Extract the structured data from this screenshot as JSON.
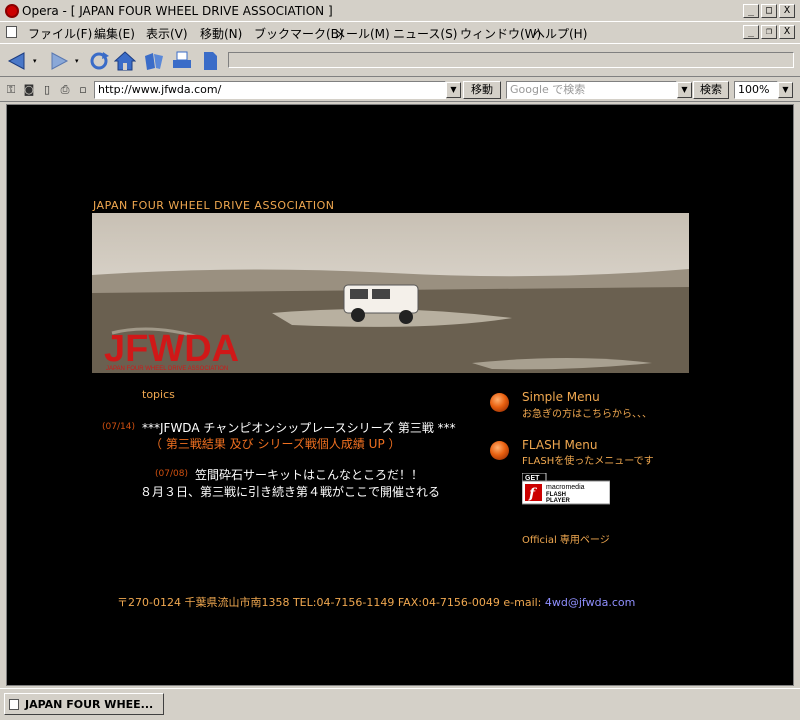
{
  "window": {
    "title": "Opera - [ JAPAN FOUR WHEEL DRIVE ASSOCIATION ]",
    "minimize_glyph": "_",
    "maximize_glyph": "□",
    "close_glyph": "X",
    "restore_glyph": "❐"
  },
  "menubar": {
    "items": [
      "ファイル(F)",
      "編集(E)",
      "表示(V)",
      "移動(N)",
      "ブックマーク(B)",
      "メール(M)",
      "ニュース(S)",
      "ウィンドウ(W)",
      "ヘルプ(H)"
    ]
  },
  "toolbar": {
    "icons": [
      "back-icon",
      "forward-icon",
      "reload-icon",
      "home-icon",
      "hotlist-icon",
      "print-icon",
      "page-icon"
    ]
  },
  "addressbar": {
    "url": "http://www.jfwda.com/",
    "go_label": "移動",
    "search_placeholder": "Google で検索",
    "search_label": "検索",
    "zoom": "100%",
    "dropdown_glyph": "▼"
  },
  "page": {
    "header": "JAPAN FOUR WHEEL DRIVE ASSOCIATION",
    "banner": {
      "logo": "JFWDA",
      "logo_sub": "JAPAN FOUR WHEEL DRIVE ASSOCIATION"
    },
    "topics_label": "topics",
    "news": [
      {
        "date": "(07/14)",
        "title": "***JFWDA チャンピオンシップレースシリーズ 第三戦 ***",
        "subtitle": "（ 第三戦結果 及び シリーズ戦個人成績 UP ）"
      },
      {
        "date": "(07/08)",
        "title": "笠間砕石サーキットはこんなところだ！！",
        "body": "８月３日、第三戦に引き続き第４戦がここで開催される"
      }
    ],
    "menus": [
      {
        "label": "Simple Menu",
        "desc": "お急ぎの方はこちらから、、、"
      },
      {
        "label": "FLASH Menu",
        "desc": "FLASHを使ったメニューです"
      }
    ],
    "flash_badge": {
      "get": "GET",
      "brand": "macromedia",
      "product1": "FLASH",
      "product2": "PLAYER",
      "glyph": "f"
    },
    "official": "Official 専用ページ",
    "footer": {
      "address": "〒270-0124  千葉県流山市南1358  TEL:04-7156-1149  FAX:04-7156-0049  e-mail: ",
      "email": "4wd@jfwda.com"
    }
  },
  "tabbar": {
    "tab_label": "JAPAN FOUR WHEE..."
  },
  "colors": {
    "accent_orange": "#f0a850",
    "date_red": "#d05010",
    "link_blue": "#9090ff",
    "chrome": "#d4d0c8"
  }
}
